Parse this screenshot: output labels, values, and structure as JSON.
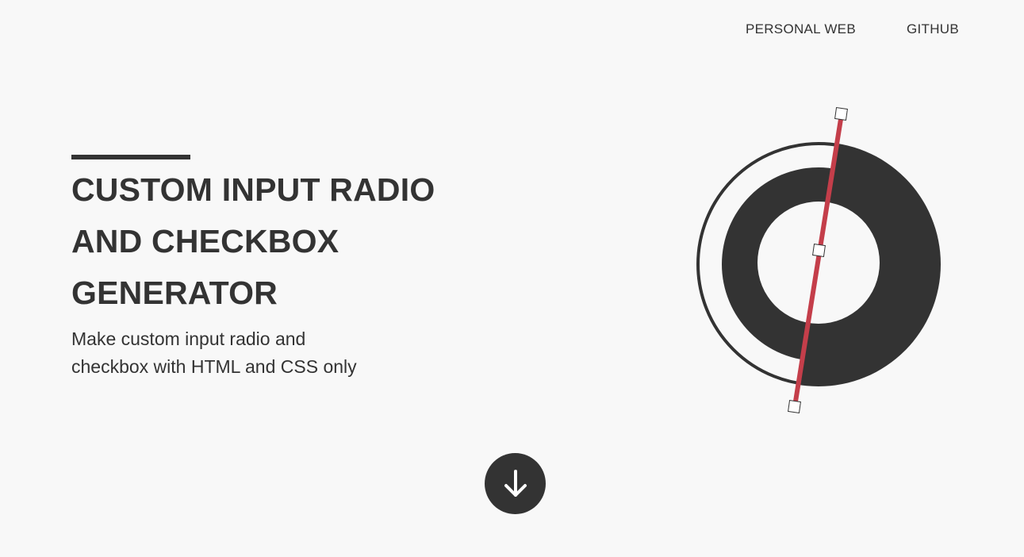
{
  "nav": {
    "links": [
      {
        "label": "PERSONAL WEB"
      },
      {
        "label": "GITHUB"
      }
    ]
  },
  "hero": {
    "title_lines": [
      "CUSTOM INPUT RADIO",
      "AND CHECKBOX",
      "GENERATOR"
    ],
    "subtitle_lines": [
      "Make custom input radio and",
      "checkbox with HTML and CSS only"
    ]
  },
  "logo": {
    "icon": "radio-checkbox-logo-icon",
    "ring_color": "#333333",
    "accent_color": "#c43e4a"
  },
  "scroll": {
    "icon": "arrow-down-icon"
  }
}
